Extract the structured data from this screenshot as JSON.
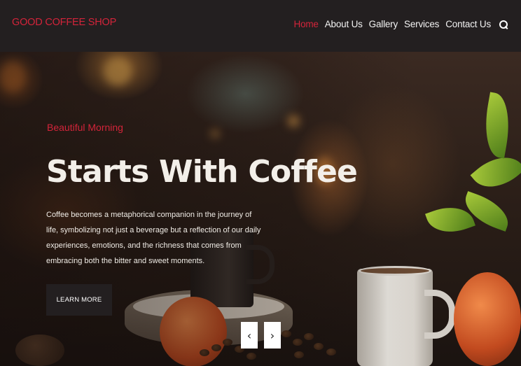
{
  "brand": "GOOD COFFEE SHOP",
  "nav": {
    "items": [
      "Home",
      "About Us",
      "Gallery",
      "Services",
      "Contact Us"
    ],
    "active": "Home",
    "search_icon": "search-icon"
  },
  "hero": {
    "subtitle": "Beautiful Morning",
    "headline": "Starts With Coffee",
    "description": "Coffee becomes a metaphorical companion in the journey of life, symbolizing not just a beverage but a reflection of our daily experiences, emotions, and the richness that comes from embracing both the bitter and sweet moments.",
    "button_label": "LEARN MORE",
    "prev_label": "‹",
    "next_label": "›"
  },
  "colors": {
    "accent": "#d3243a",
    "navbar": "#231f20",
    "text_light": "#f3efe9"
  }
}
